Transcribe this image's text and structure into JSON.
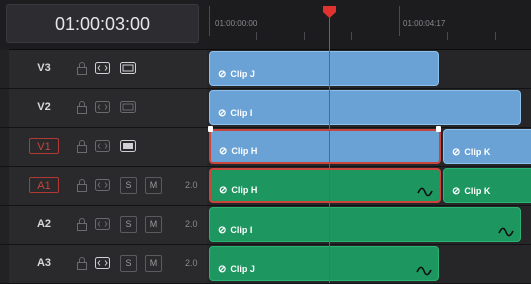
{
  "timecode": "01:00:03:00",
  "ruler": {
    "labels": [
      "01:00:00:00",
      "01:00:04:17"
    ]
  },
  "colors": {
    "video_clip": "#6aa2d6",
    "audio_clip": "#1e9660",
    "selection": "#c8463d",
    "playhead": "#e0332f"
  },
  "tracks": [
    {
      "name": "V3",
      "type": "video",
      "channels": "",
      "clips": [
        "Clip J"
      ]
    },
    {
      "name": "V2",
      "type": "video",
      "channels": "",
      "clips": [
        "Clip I"
      ]
    },
    {
      "name": "V1",
      "type": "video",
      "channels": "",
      "clips": [
        "Clip H",
        "Clip K"
      ]
    },
    {
      "name": "A1",
      "type": "audio",
      "channels": "2.0",
      "clips": [
        "Clip H",
        "Clip K"
      ]
    },
    {
      "name": "A2",
      "type": "audio",
      "channels": "2.0",
      "clips": [
        "Clip I"
      ]
    },
    {
      "name": "A3",
      "type": "audio",
      "channels": "2.0",
      "clips": [
        "Clip J"
      ]
    }
  ],
  "track_controls": {
    "solo_label": "S",
    "mute_label": "M",
    "lock_icon": "lock-icon",
    "auto_select_icon": "auto-select-icon",
    "enable_icon": "track-enable-icon"
  },
  "link_glyph": "⊘"
}
